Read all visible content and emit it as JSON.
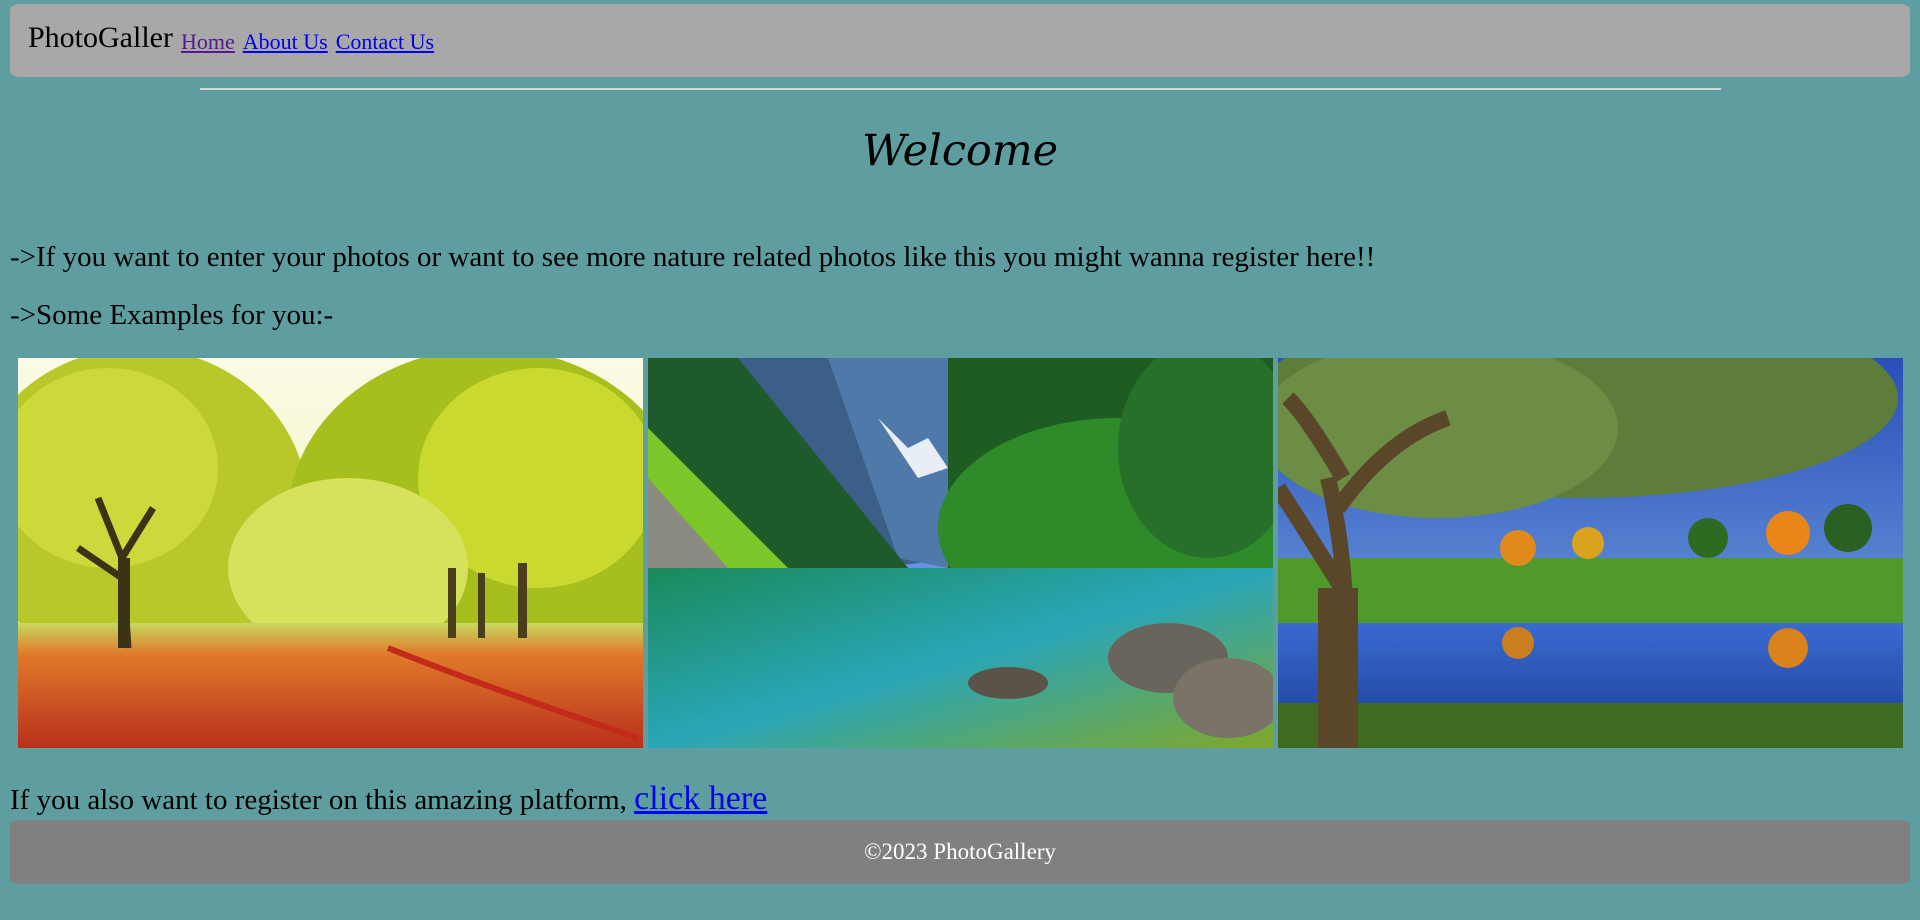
{
  "header": {
    "brand": "PhotoGaller",
    "nav": [
      {
        "label": "Home"
      },
      {
        "label": "About Us"
      },
      {
        "label": "Contact Us"
      }
    ]
  },
  "main": {
    "title": "Welcome",
    "intro": "->If you want to enter your photos or want to see more nature related photos like this you might wanna register here!!",
    "examples_heading": "->Some Examples for you:-",
    "register_text": "If you also want to register on this amazing platform,",
    "register_link": "click here"
  },
  "footer": {
    "text": "©2023 PhotoGallery"
  },
  "colors": {
    "background": "#5f9ea0",
    "header_bg": "#a8a8a8",
    "footer_bg": "#808080",
    "link": "#0000ee",
    "visited_link": "#551a8b"
  }
}
